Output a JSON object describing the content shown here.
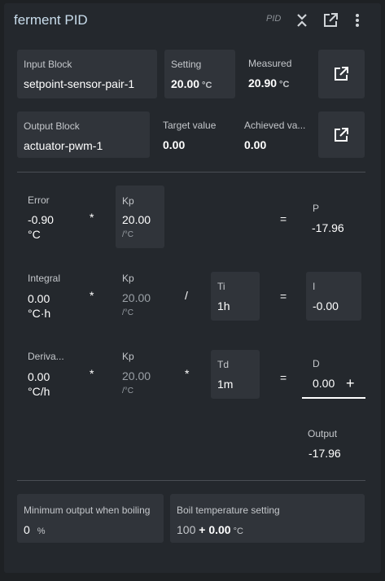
{
  "header": {
    "title": "ferment PID",
    "type_tag": "PID"
  },
  "row1": {
    "input_block_label": "Input Block",
    "input_block_value": "setpoint-sensor-pair-1",
    "setting_label": "Setting",
    "setting_value": "20.00",
    "setting_unit": "°C",
    "measured_label": "Measured",
    "measured_value": "20.90",
    "measured_unit": "°C"
  },
  "row2": {
    "output_block_label": "Output Block",
    "output_block_value": "actuator-pwm-1",
    "target_label": "Target value",
    "target_value": "0.00",
    "achieved_label": "Achieved va...",
    "achieved_value": "0.00"
  },
  "p_row": {
    "error_label": "Error",
    "error_value": "-0.90",
    "error_unit": "°C",
    "kp_label": "Kp",
    "kp_value": "20.00",
    "kp_unit": "/°C",
    "p_label": "P",
    "p_value": "-17.96"
  },
  "i_row": {
    "integral_label": "Integral",
    "integral_value": "0.00",
    "integral_unit": "°C·h",
    "kp_label": "Kp",
    "kp_value": "20.00",
    "kp_unit": "/°C",
    "ti_label": "Ti",
    "ti_value": "1h",
    "i_label": "I",
    "i_value": "-0.00"
  },
  "d_row": {
    "derivative_label": "Deriva...",
    "derivative_value": "0.00",
    "derivative_unit": "°C/h",
    "kp_label": "Kp",
    "kp_value": "20.00",
    "kp_unit": "/°C",
    "td_label": "Td",
    "td_value": "1m",
    "d_label": "D",
    "d_value": "0.00"
  },
  "output": {
    "label": "Output",
    "value": "-17.96"
  },
  "boil": {
    "min_output_label": "Minimum output when boiling",
    "min_output_value": "0",
    "min_output_unit": "%",
    "boil_temp_label": "Boil temperature setting",
    "boil_temp_base": "100",
    "boil_temp_plus": "+",
    "boil_temp_offset": "0.00",
    "boil_temp_unit": "°C"
  },
  "operators": {
    "multiply": "*",
    "divide": "/",
    "equals": "=",
    "plus": "+"
  },
  "colors": {
    "background": "#24282d",
    "card": "#30343a",
    "title": "#c9ddec"
  },
  "icons": [
    "collapse-icon",
    "open-in-new-icon",
    "more-vert-icon"
  ]
}
